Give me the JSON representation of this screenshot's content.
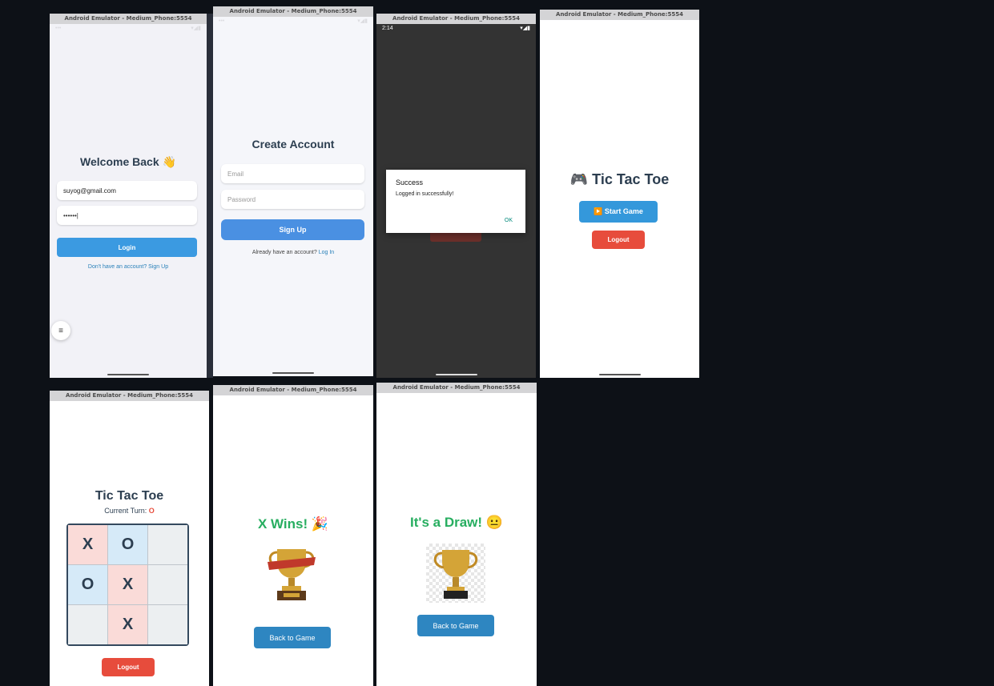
{
  "window_title": "Android Emulator - Medium_Phone:5554",
  "colors": {
    "primary_blue": "#3b9ae1",
    "danger_red": "#e74c3c",
    "success_green": "#27ae60",
    "dark_text": "#2c3e50",
    "x_cell": "#fadbd8",
    "o_cell": "#d6eaf8",
    "empty_cell": "#eceff1"
  },
  "login": {
    "heading": "Welcome Back 👋",
    "email_value": "suyog@gmail.com",
    "password_value": "••••••|",
    "login_button": "Login",
    "signup_link": "Don't have an account? Sign Up",
    "fab_icon": "menu-icon"
  },
  "signup": {
    "heading": "Create Account",
    "email_placeholder": "Email",
    "password_placeholder": "Password",
    "signup_button": "Sign Up",
    "login_prompt": "Already have an account?",
    "login_link": "Log In"
  },
  "dialog_screen": {
    "status_time": "2:14",
    "dialog_title": "Success",
    "dialog_message": "Logged in successfully!",
    "ok_button": "OK"
  },
  "home": {
    "title": "🎮 Tic Tac Toe",
    "start_button": "▶️ Start Game",
    "logout_button": "Logout"
  },
  "game": {
    "title": "Tic Tac Toe",
    "turn_label": "Current Turn:",
    "turn_value": "O",
    "board": [
      "X",
      "O",
      "",
      "O",
      "X",
      "",
      "",
      "X",
      ""
    ],
    "logout_button": "Logout"
  },
  "win": {
    "heading": "X Wins! 🎉",
    "back_button": "Back to Game"
  },
  "draw": {
    "heading": "It's a Draw! 😐",
    "back_button": "Back to Game"
  }
}
